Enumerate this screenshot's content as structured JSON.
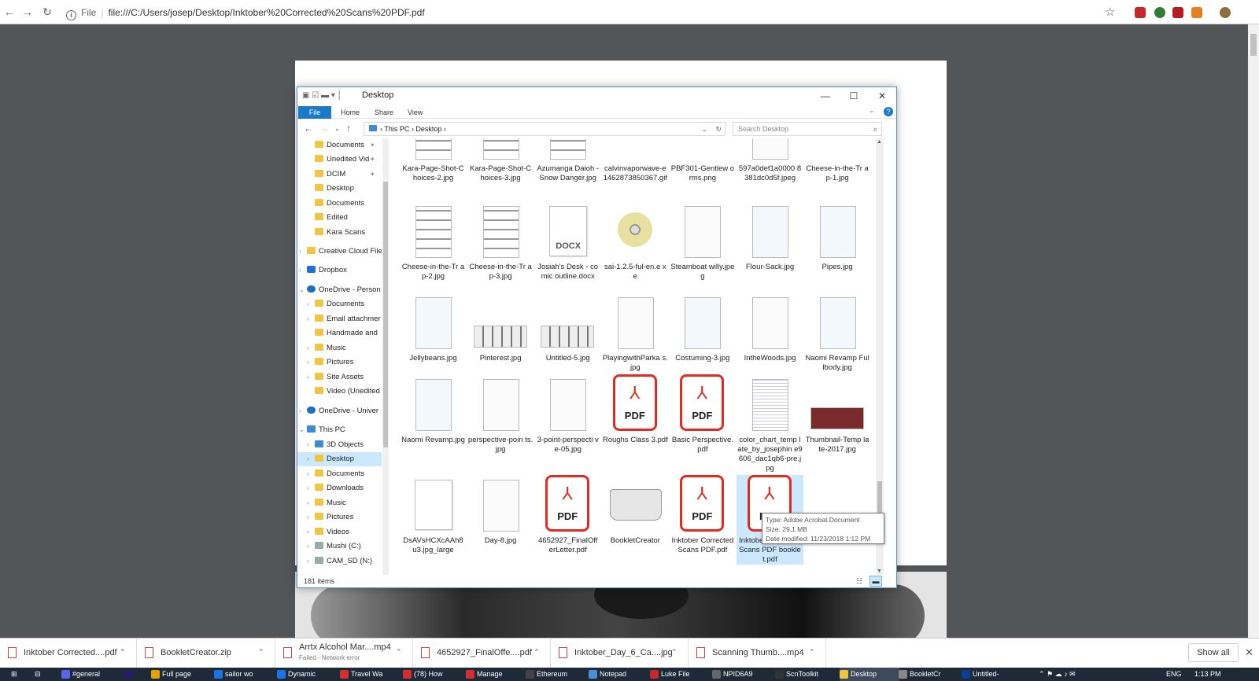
{
  "browser": {
    "url_scheme": "File",
    "url": "file:///C:/Users/josep/Desktop/Inktober%20Corrected%20Scans%20PDF.pdf"
  },
  "explorer": {
    "title": "Desktop",
    "ribbon_tabs": [
      "File",
      "Home",
      "Share",
      "View"
    ],
    "path": [
      "This PC",
      "Desktop"
    ],
    "search_placeholder": "Search Desktop",
    "nav_items": [
      {
        "label": "Documents",
        "pinned": true
      },
      {
        "label": "Unedited Vid",
        "pinned": true
      },
      {
        "label": "DCIM",
        "pinned": true
      },
      {
        "label": "Desktop"
      },
      {
        "label": "Documents"
      },
      {
        "label": "Edited"
      },
      {
        "label": "Kara Scans"
      },
      {
        "label": "Creative Cloud File"
      },
      {
        "label": "Dropbox"
      },
      {
        "label": "OneDrive - Person"
      },
      {
        "label": "Documents"
      },
      {
        "label": "Email attachmer"
      },
      {
        "label": "Handmade and"
      },
      {
        "label": "Music"
      },
      {
        "label": "Pictures"
      },
      {
        "label": "Site Assets"
      },
      {
        "label": "Video (Unedited"
      },
      {
        "label": "OneDrive - Univer"
      },
      {
        "label": "This PC"
      },
      {
        "label": "3D Objects"
      },
      {
        "label": "Desktop"
      },
      {
        "label": "Documents"
      },
      {
        "label": "Downloads"
      },
      {
        "label": "Music"
      },
      {
        "label": "Pictures"
      },
      {
        "label": "Videos"
      },
      {
        "label": "Mushi (C:)"
      },
      {
        "label": "CAM_SD (N:)"
      }
    ],
    "files": [
      {
        "name": "Kara-Page-Shot-Choices-2.jpg",
        "kind": "comic"
      },
      {
        "name": "Kara-Page-Shot-Choices-3.jpg",
        "kind": "comic"
      },
      {
        "name": "Azumanga Daioh - Snow Danger.jpg",
        "kind": "comic"
      },
      {
        "name": "calvinvaporwave-e1462873850367.gif",
        "kind": "strip"
      },
      {
        "name": "PBF301-Gentlew orms.png",
        "kind": "photo"
      },
      {
        "name": "597a0def1a0000 8381dc0d5f.jpeg",
        "kind": "sketch"
      },
      {
        "name": "Cheese-in-the-Tr ap-1.jpg",
        "kind": "strip"
      },
      {
        "name": "Cheese-in-the-Tr ap-2.jpg",
        "kind": "comic"
      },
      {
        "name": "Cheese-in-the-Tr ap-3.jpg",
        "kind": "comic"
      },
      {
        "name": "Josiah's Desk - comic outline.docx",
        "kind": "docx"
      },
      {
        "name": "sai-1.2.5-ful-en.e xe",
        "kind": "exe"
      },
      {
        "name": "Steamboat willy.jpeg",
        "kind": "sketch"
      },
      {
        "name": "Flour-Sack.jpg",
        "kind": "blue"
      },
      {
        "name": "Pipes.jpg",
        "kind": "blue"
      },
      {
        "name": "Jellybeans.jpg",
        "kind": "blue"
      },
      {
        "name": "Pinterest.jpg",
        "kind": "strip"
      },
      {
        "name": "Untitled-5.jpg",
        "kind": "strip"
      },
      {
        "name": "PlayingwithParka s.jpg",
        "kind": "sketch"
      },
      {
        "name": "Costuming-3.jpg",
        "kind": "blue"
      },
      {
        "name": "IntheWoods.jpg",
        "kind": "sketch"
      },
      {
        "name": "Naomi Revamp Fullbody.jpg",
        "kind": "blue"
      },
      {
        "name": "Naomi Revamp.jpg",
        "kind": "blue"
      },
      {
        "name": "perspective-poin ts.jpg",
        "kind": "sketch"
      },
      {
        "name": "3-point-perspecti ve-05.jpg",
        "kind": "sketch"
      },
      {
        "name": "Roughs Class 3.pdf",
        "kind": "pdf"
      },
      {
        "name": "Basic Perspective.pdf",
        "kind": "pdf"
      },
      {
        "name": "color_chart_temp late_by_josephin e9606_dac1qb6-pre.jpg",
        "kind": "grid"
      },
      {
        "name": "Thumbnail-Temp late-2017.jpg",
        "kind": "red"
      },
      {
        "name": "DsAVsHCXcAAh8 u3.jpg_large",
        "kind": "blank"
      },
      {
        "name": "Day-8.jpg",
        "kind": "sketch"
      },
      {
        "name": "4652927_FinalOff erLetter.pdf",
        "kind": "pdf"
      },
      {
        "name": "BookletCreator",
        "kind": "book"
      },
      {
        "name": "Inktober Corrected Scans PDF.pdf",
        "kind": "pdf"
      },
      {
        "name": "Inktober Corrected Scans PDF booklet.pdf",
        "kind": "pdf"
      }
    ],
    "status": "181 items",
    "tooltip": [
      "Type: Adobe Acrobat Document",
      "Size: 29.1 MB",
      "Date modified: 11/23/2018 1:12 PM"
    ]
  },
  "downloads": {
    "items": [
      {
        "name": "Inktober Corrected....pdf",
        "sub": ""
      },
      {
        "name": "BookletCreator.zip",
        "sub": ""
      },
      {
        "name": "Arrtx Alcohol Mar....mp4",
        "sub": "Failed - Network error"
      },
      {
        "name": "4652927_FinalOffe....pdf",
        "sub": ""
      },
      {
        "name": "Inktober_Day_6_Ca....jpg",
        "sub": ""
      },
      {
        "name": "Scanning Thumb....mp4",
        "sub": ""
      }
    ],
    "show_all": "Show all"
  },
  "taskbar": {
    "items": [
      "#general",
      "",
      "Full page",
      "sailor wo",
      "Dynamic",
      "Travel Wa",
      "(78) How",
      "Manage",
      "Ethereum",
      "Notepad",
      "Luke File",
      "NPID6A9",
      "ScnToolkit",
      "Desktop",
      "BookletCr",
      "Untitled-"
    ],
    "lang": "ENG",
    "time": "1:13 PM"
  },
  "colors": {
    "accent": "#1979ca",
    "pdf_red": "#e32b22",
    "selection": "#cce8ff"
  }
}
